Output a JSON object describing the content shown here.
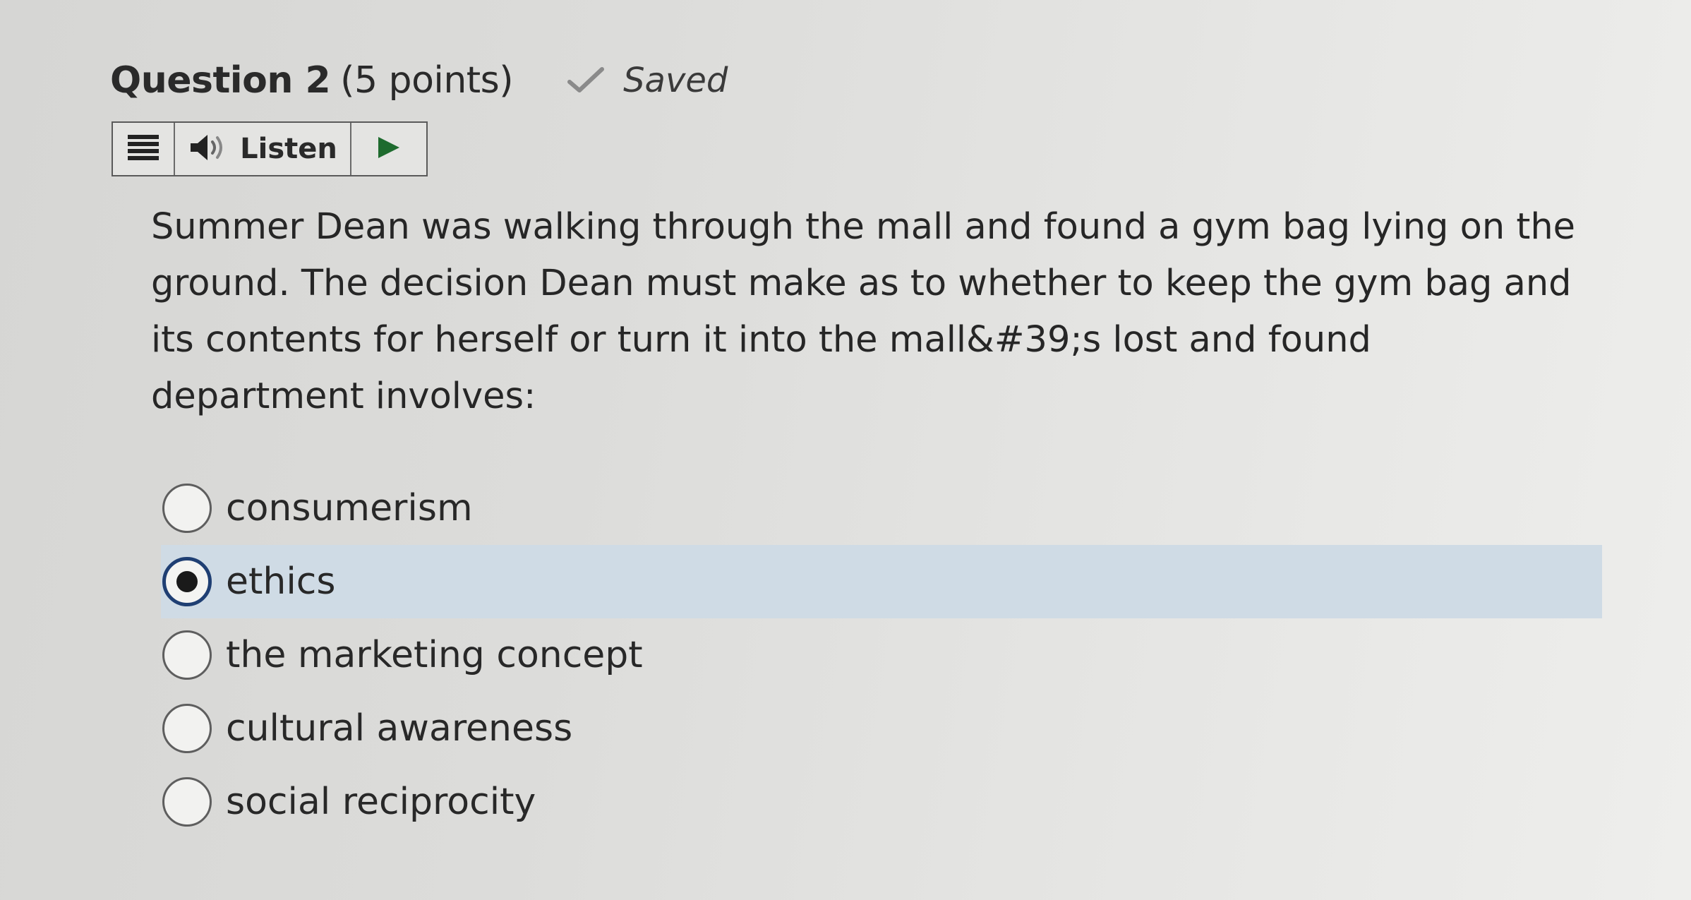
{
  "question": {
    "title": "Question 2",
    "points": "(5 points)",
    "status": "Saved",
    "text": "Summer Dean was walking through the mall and found a gym bag lying on the ground.  The decision Dean must make as to whether to keep the gym bag and its contents for herself or turn it into the mall&#39;s lost and found department involves:"
  },
  "listen_bar": {
    "listen_label": "Listen"
  },
  "icons": {
    "saved": "checkmark-icon",
    "menu": "menu-lines-icon",
    "listen": "speaker-icon",
    "play": "play-icon"
  },
  "options": [
    {
      "label": "consumerism",
      "selected": false
    },
    {
      "label": "ethics",
      "selected": true
    },
    {
      "label": "the marketing concept",
      "selected": false
    },
    {
      "label": "cultural awareness",
      "selected": false
    },
    {
      "label": "social reciprocity",
      "selected": false
    }
  ],
  "colors": {
    "selected_row": "#cfdbe5",
    "radio_checked_border": "#1f3f73",
    "play_icon": "#1e6b2e"
  }
}
